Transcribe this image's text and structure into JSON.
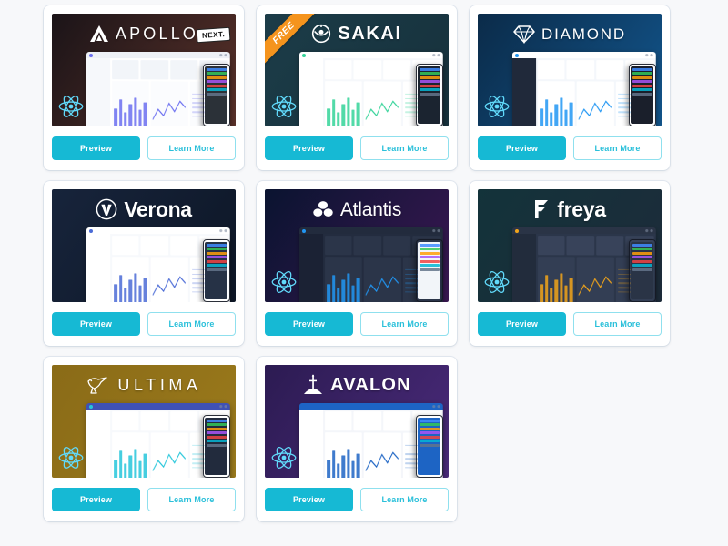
{
  "page": {
    "background_color": "#f7f8fa",
    "card_background": "#ffffff",
    "accent_color": "#16b9d4",
    "ribbon_color": "#f5941d",
    "react_badge_color": "#61dafb",
    "columns": 3
  },
  "buttons": {
    "preview_label": "Preview",
    "learn_more_label": "Learn More"
  },
  "badges": {
    "free_label": "FREE",
    "react_icon_name": "react-logo-icon"
  },
  "cards": [
    {
      "id": "apollo",
      "name": "APOLLO",
      "logo_icon": "apollo-chevron-icon",
      "has_react_badge": true,
      "has_free_ribbon": true,
      "free_label": "FREE",
      "free_visible": false,
      "has_next_badge": true,
      "next_badge_label": "NEXT.",
      "preview_label": "Preview",
      "learn_more_label": "Learn More",
      "theme": {
        "bg_from": "#1b1418",
        "bg_to": "#5a3129",
        "shot_chrome": "#eef1f6",
        "shot_side": "#f6f8fb",
        "shot_main": "#ffffff",
        "kpi": "#f2f5f9",
        "pane": "#fbfcfe",
        "accent": "#6b6ff0",
        "phone_bg": "#2b3138"
      }
    },
    {
      "id": "sakai",
      "name": "SAKAI",
      "logo_icon": "sakai-eye-icon",
      "has_react_badge": true,
      "has_free_ribbon": true,
      "free_label": "FREE",
      "free_visible": true,
      "has_next_badge": false,
      "next_badge_label": "",
      "preview_label": "Preview",
      "learn_more_label": "Learn More",
      "theme": {
        "bg_from": "#1c3c48",
        "bg_to": "#16313c",
        "shot_chrome": "#ffffff",
        "shot_side": "#ffffff",
        "shot_main": "#f6f8fb",
        "kpi": "#ffffff",
        "pane": "#ffffff",
        "accent": "#34d399",
        "phone_bg": "#1b2430"
      }
    },
    {
      "id": "diamond",
      "name": "DIAMOND",
      "logo_icon": "diamond-gem-icon",
      "has_react_badge": true,
      "has_free_ribbon": false,
      "free_label": "FREE",
      "free_visible": false,
      "has_next_badge": false,
      "next_badge_label": "",
      "preview_label": "Preview",
      "learn_more_label": "Learn More",
      "theme": {
        "bg_from": "#0b2b49",
        "bg_to": "#12558c",
        "shot_chrome": "#ffffff",
        "shot_side": "#20293a",
        "shot_main": "#f4f7fb",
        "kpi": "#ffffff",
        "pane": "#ffffff",
        "accent": "#2196f3",
        "phone_bg": "#1a1f2b"
      }
    },
    {
      "id": "verona",
      "name": "Verona",
      "logo_icon": "verona-v-circle-icon",
      "has_react_badge": false,
      "has_free_ribbon": false,
      "free_label": "FREE",
      "free_visible": false,
      "has_next_badge": false,
      "next_badge_label": "",
      "preview_label": "Preview",
      "learn_more_label": "Learn More",
      "theme": {
        "bg_from": "#17243b",
        "bg_to": "#0d1626",
        "shot_chrome": "#ffffff",
        "shot_side": "#ffffff",
        "shot_main": "#f7f9fc",
        "kpi": "#ffffff",
        "pane": "#ffffff",
        "accent": "#4b6bd6",
        "phone_bg": "#263246"
      }
    },
    {
      "id": "atlantis",
      "name": "Atlantis",
      "logo_icon": "atlantis-petals-icon",
      "has_react_badge": true,
      "has_free_ribbon": false,
      "free_label": "FREE",
      "free_visible": false,
      "has_next_badge": false,
      "next_badge_label": "",
      "preview_label": "Preview",
      "learn_more_label": "Learn More",
      "theme": {
        "bg_from": "#0a1430",
        "bg_to": "#3a1752",
        "shot_chrome": "#222b3d",
        "shot_side": "#1b2234",
        "shot_main": "#232c3f",
        "kpi": "#2b3549",
        "pane": "#2b3549",
        "accent": "#2196f3",
        "phone_bg": "#f2f5f9"
      }
    },
    {
      "id": "freya",
      "name": "freya",
      "logo_icon": "freya-f-icon",
      "has_react_badge": true,
      "has_free_ribbon": false,
      "free_label": "FREE",
      "free_visible": false,
      "has_next_badge": false,
      "next_badge_label": "",
      "preview_label": "Preview",
      "learn_more_label": "Learn More",
      "theme": {
        "bg_from": "#13333a",
        "bg_to": "#1d2b3a",
        "shot_chrome": "#2a3446",
        "shot_side": "#222c3c",
        "shot_main": "#2b364a",
        "kpi": "#38435a",
        "pane": "#333e54",
        "accent": "#f2a51a",
        "phone_bg": "#2a3446"
      }
    },
    {
      "id": "ultima",
      "name": "ULTIMA",
      "logo_icon": "ultima-bird-icon",
      "has_react_badge": true,
      "has_free_ribbon": false,
      "free_label": "FREE",
      "free_visible": false,
      "has_next_badge": false,
      "next_badge_label": "",
      "preview_label": "Preview",
      "learn_more_label": "Learn More",
      "theme": {
        "bg_from": "#8a6b17",
        "bg_to": "#9b7a1c",
        "shot_chrome": "#3f51b5",
        "shot_side": "#ffffff",
        "shot_main": "#f7f9fc",
        "kpi": "#ffffff",
        "pane": "#ffffff",
        "accent": "#26c6da",
        "phone_bg": "#222b3d"
      }
    },
    {
      "id": "avalon",
      "name": "AVALON",
      "logo_icon": "avalon-sword-icon",
      "has_react_badge": true,
      "has_free_ribbon": false,
      "free_label": "FREE",
      "free_visible": false,
      "has_next_badge": false,
      "next_badge_label": "",
      "preview_label": "Preview",
      "learn_more_label": "Learn More",
      "theme": {
        "bg_from": "#2c1b52",
        "bg_to": "#4a2a7a",
        "shot_chrome": "#1d64c4",
        "shot_side": "#ffffff",
        "shot_main": "#f4f6fa",
        "kpi": "#ffffff",
        "pane": "#ffffff",
        "accent": "#1d64c4",
        "phone_bg": "#1d64c4"
      }
    }
  ]
}
